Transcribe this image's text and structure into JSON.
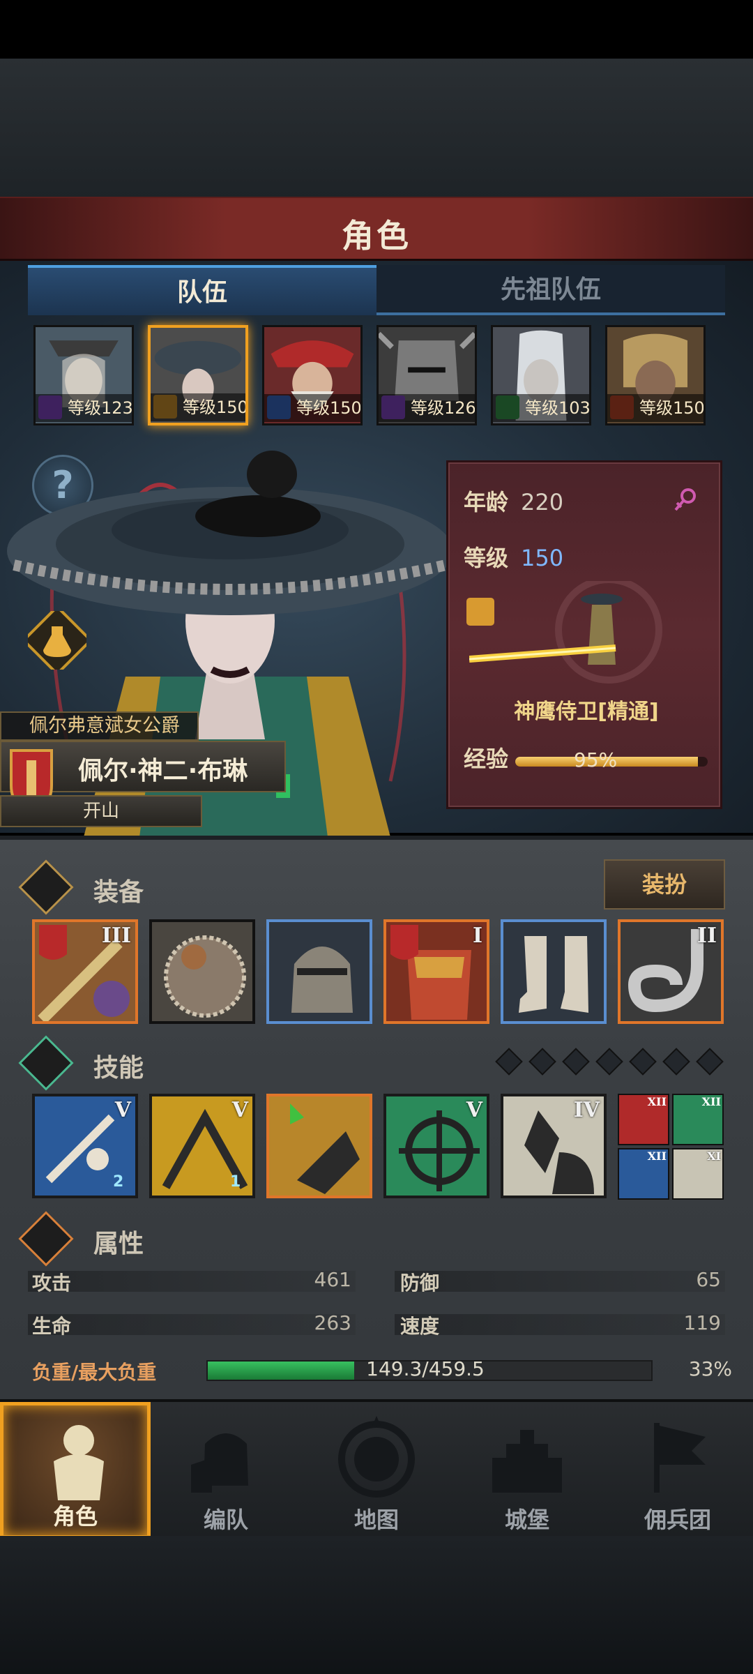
{
  "screen": {
    "title": "角色"
  },
  "tabs": [
    {
      "label": "队伍",
      "active": true
    },
    {
      "label": "先祖队伍",
      "active": false
    }
  ],
  "heroes": [
    {
      "level_text": "等级123",
      "class_color": "#8a4bd0",
      "selected": false
    },
    {
      "level_text": "等级150",
      "class_color": "#d89a30",
      "selected": true
    },
    {
      "level_text": "等级150",
      "class_color": "#3c6fd0",
      "selected": false
    },
    {
      "level_text": "等级126",
      "class_color": "#8a4bd0",
      "selected": false
    },
    {
      "level_text": "等级103",
      "class_color": "#3aa050",
      "selected": false
    },
    {
      "level_text": "等级150",
      "class_color": "#c84a2a",
      "selected": false
    }
  ],
  "character": {
    "title": "佩尔弗意斌女公爵",
    "name": "佩尔·神二·布琳",
    "subtitle": "开山",
    "age_label": "年龄",
    "age": "220",
    "level_label": "等级",
    "level": "150",
    "rank": "神鹰侍卫[精通]",
    "exp_label": "经验",
    "exp_text": "95%",
    "exp_fraction": 0.95
  },
  "equipment": {
    "section_label": "装备",
    "dress_button": "装扮",
    "slots": [
      {
        "name": "weapon",
        "rank": "III",
        "rarity": "orange"
      },
      {
        "name": "offhand-shield",
        "rank": "",
        "rarity": "grey"
      },
      {
        "name": "helmet",
        "rank": "",
        "rarity": "blue"
      },
      {
        "name": "armor",
        "rank": "I",
        "rarity": "orange"
      },
      {
        "name": "boots",
        "rank": "",
        "rarity": "blue"
      },
      {
        "name": "accessory",
        "rank": "II",
        "rarity": "orange"
      }
    ]
  },
  "skills": {
    "section_label": "技能",
    "items": [
      {
        "rank": "V",
        "badge": "2"
      },
      {
        "rank": "V",
        "badge": "1"
      },
      {
        "rank": "",
        "badge": ""
      },
      {
        "rank": "V",
        "badge": ""
      },
      {
        "rank": "IV",
        "badge": ""
      }
    ],
    "mini": [
      "XII",
      "XII",
      "XII",
      "XI"
    ]
  },
  "attributes": {
    "section_label": "属性",
    "attack_label": "攻击",
    "attack": "461",
    "defense_label": "防御",
    "defense": "65",
    "hp_label": "生命",
    "hp": "263",
    "speed_label": "速度",
    "speed": "119",
    "load_label": "负重/最大负重",
    "load_text": "149.3/459.5",
    "load_percent": "33%",
    "load_fraction": 0.33
  },
  "nav": [
    {
      "label": "角色",
      "active": true
    },
    {
      "label": "编队",
      "active": false
    },
    {
      "label": "地图",
      "active": false
    },
    {
      "label": "城堡",
      "active": false
    },
    {
      "label": "佣兵团",
      "active": false
    }
  ],
  "colors": {
    "accent": "#f0a020",
    "title_bar": "#7a2a26",
    "tab_active": "#2a4c72",
    "exp": "#e8b84a",
    "load": "#2fae55"
  }
}
